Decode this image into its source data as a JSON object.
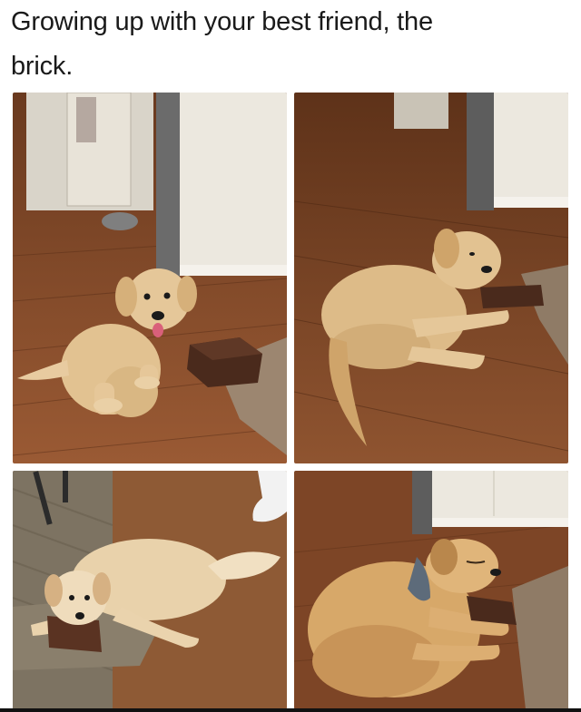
{
  "post": {
    "caption_line1": "Growing up with your best friend, the",
    "caption_line2": "brick."
  },
  "panels": [
    {
      "subject": "puppy sitting beside brick"
    },
    {
      "subject": "puppy lying with head on brick"
    },
    {
      "subject": "older dog lying on brick on rug"
    },
    {
      "subject": "grown dog sleeping on brick"
    }
  ],
  "colors": {
    "floor": "#8a4f2c",
    "floor_dark": "#5e3219",
    "wall": "#e9e4dc",
    "dog": "#e2c291",
    "dog_shadow": "#c59b63",
    "brick": "#4a2a1c",
    "rug": "#8f7b66"
  }
}
